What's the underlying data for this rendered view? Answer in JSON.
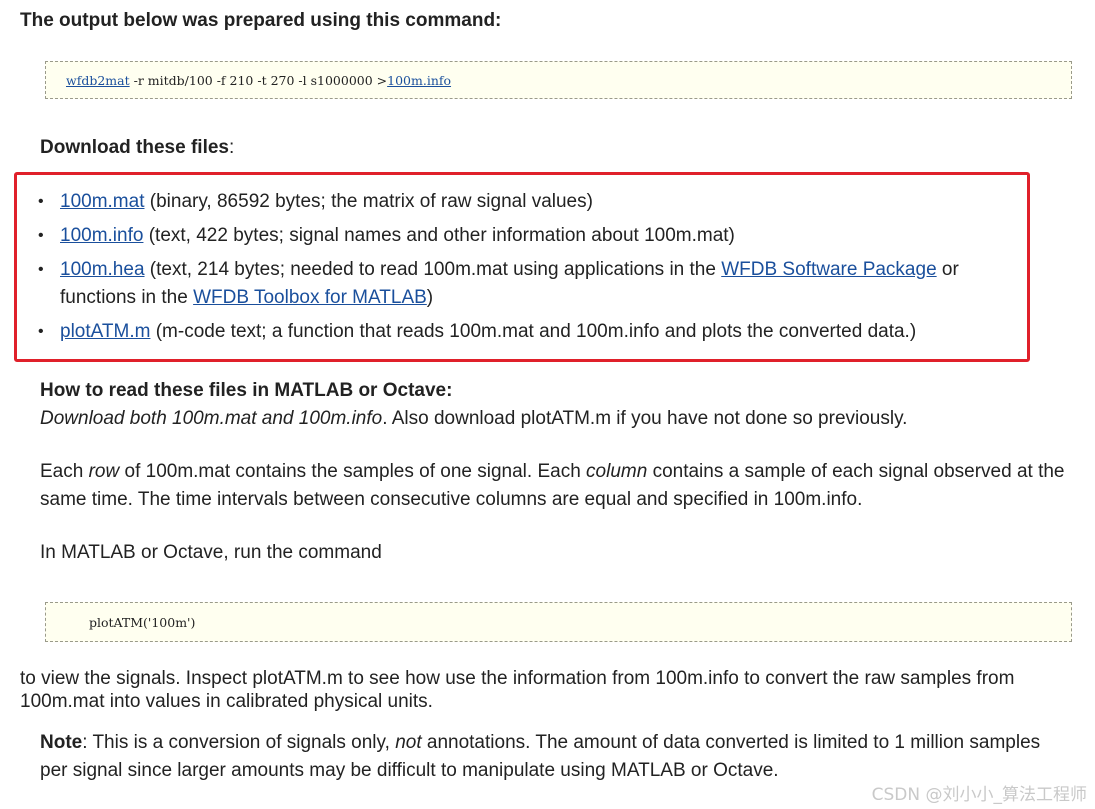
{
  "heading": "The output below was prepared using this command:",
  "command": {
    "tool_link": "wfdb2mat",
    "args": " -r mitdb/100 -f 210 -t 270 -l s1000000 >",
    "output_link": "100m.info"
  },
  "download": {
    "label_bold": "Download these files",
    "label_colon": ":",
    "files": [
      {
        "link": "100m.mat",
        "text": " (binary, 86592 bytes; the matrix of raw signal values)"
      },
      {
        "link": "100m.info",
        "text": " (text, 422 bytes; signal names and other information about 100m.mat)"
      },
      {
        "link": "100m.hea",
        "text": " (text, 214 bytes; needed to read 100m.mat using applications in the ",
        "link2": "WFDB Software Package",
        "text2": " or functions in the ",
        "link3": "WFDB Toolbox for MATLAB",
        "text3": ")"
      },
      {
        "link": "plotATM.m",
        "text": " (m-code text; a function that reads 100m.mat and 100m.info and plots the converted data.)"
      }
    ]
  },
  "how": {
    "heading": "How to read these files in MATLAB or Octave:",
    "italic": "Download both 100m.mat and 100m.info",
    "rest": ". Also download plotATM.m if you have not done so previously."
  },
  "row_para": {
    "p1": "Each ",
    "i1": "row",
    "p2": " of 100m.mat contains the samples of one signal. Each ",
    "i2": "column",
    "p3": " contains a sample of each signal observed at the same time. The time intervals between consecutive columns are equal and specified in 100m.info."
  },
  "run_text": "In MATLAB or Octave, run the command",
  "command2": "plotATM('100m')",
  "view_text": "to view the signals. Inspect plotATM.m to see how use the information from 100m.info to convert the raw samples from 100m.mat into values in calibrated physical units.",
  "note": {
    "bold": "Note",
    "p1": ": This is a conversion of signals only, ",
    "italic": "not",
    "p2": " annotations. The amount of data converted is limited to 1 million samples per signal since larger amounts may be difficult to manipulate using MATLAB or Octave."
  },
  "watermark": "CSDN @刘小小_算法工程师",
  "colors": {
    "link": "#1a4f9c",
    "highlight_border": "#e0202a",
    "code_background": "#fffff0"
  }
}
